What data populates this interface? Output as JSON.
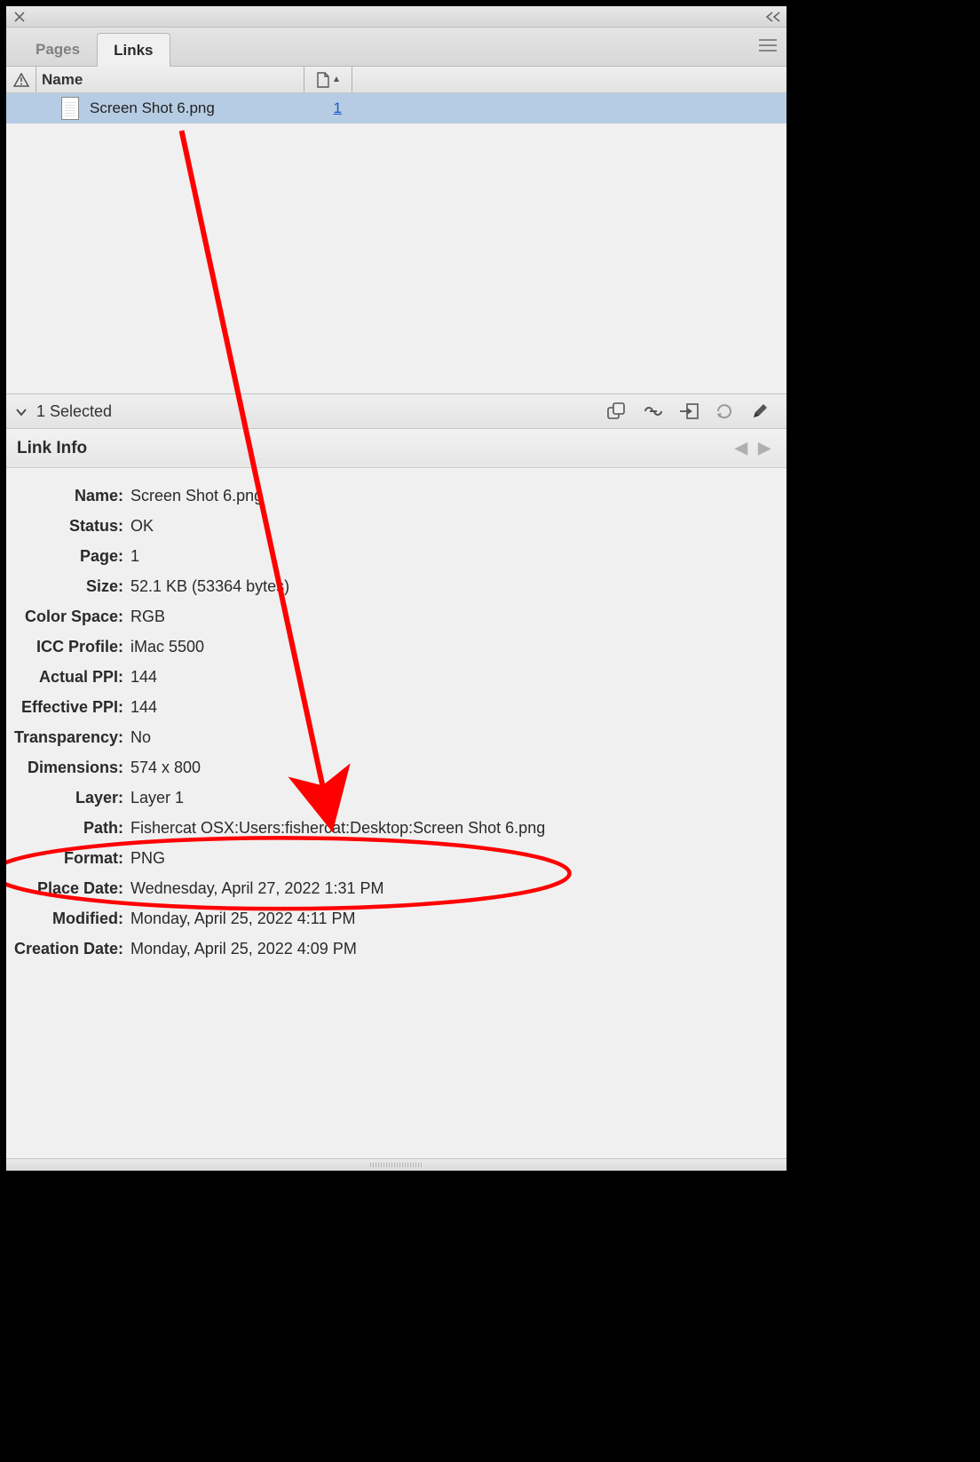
{
  "tabs": {
    "pages_label": "Pages",
    "links_label": "Links"
  },
  "columns": {
    "name_label": "Name"
  },
  "list": {
    "items": [
      {
        "file_name": "Screen Shot 6.png",
        "page": "1"
      }
    ]
  },
  "statusbar": {
    "selected_text": "1 Selected"
  },
  "info_header": "Link Info",
  "details": {
    "name": {
      "label": "Name:",
      "value": "Screen Shot 6.png"
    },
    "status": {
      "label": "Status:",
      "value": "OK"
    },
    "page": {
      "label": "Page:",
      "value": "1"
    },
    "size": {
      "label": "Size:",
      "value": "52.1 KB (53364 bytes)"
    },
    "color_space": {
      "label": "Color Space:",
      "value": "RGB"
    },
    "icc_profile": {
      "label": "ICC Profile:",
      "value": "iMac 5500"
    },
    "actual_ppi": {
      "label": "Actual PPI:",
      "value": "144"
    },
    "effective_ppi": {
      "label": "Effective PPI:",
      "value": "144"
    },
    "transparency": {
      "label": "Transparency:",
      "value": "No"
    },
    "dimensions": {
      "label": "Dimensions:",
      "value": "574 x 800"
    },
    "layer": {
      "label": "Layer:",
      "value": "Layer 1"
    },
    "path": {
      "label": "Path:",
      "value": "Fishercat OSX:Users:fishercat:Desktop:Screen Shot 6.png"
    },
    "format": {
      "label": "Format:",
      "value": "PNG"
    },
    "place_date": {
      "label": "Place Date:",
      "value": "Wednesday, April 27, 2022 1:31 PM"
    },
    "modified": {
      "label": "Modified:",
      "value": "Monday, April 25, 2022 4:11 PM"
    },
    "creation_date": {
      "label": "Creation Date:",
      "value": "Monday, April 25, 2022 4:09 PM"
    }
  }
}
